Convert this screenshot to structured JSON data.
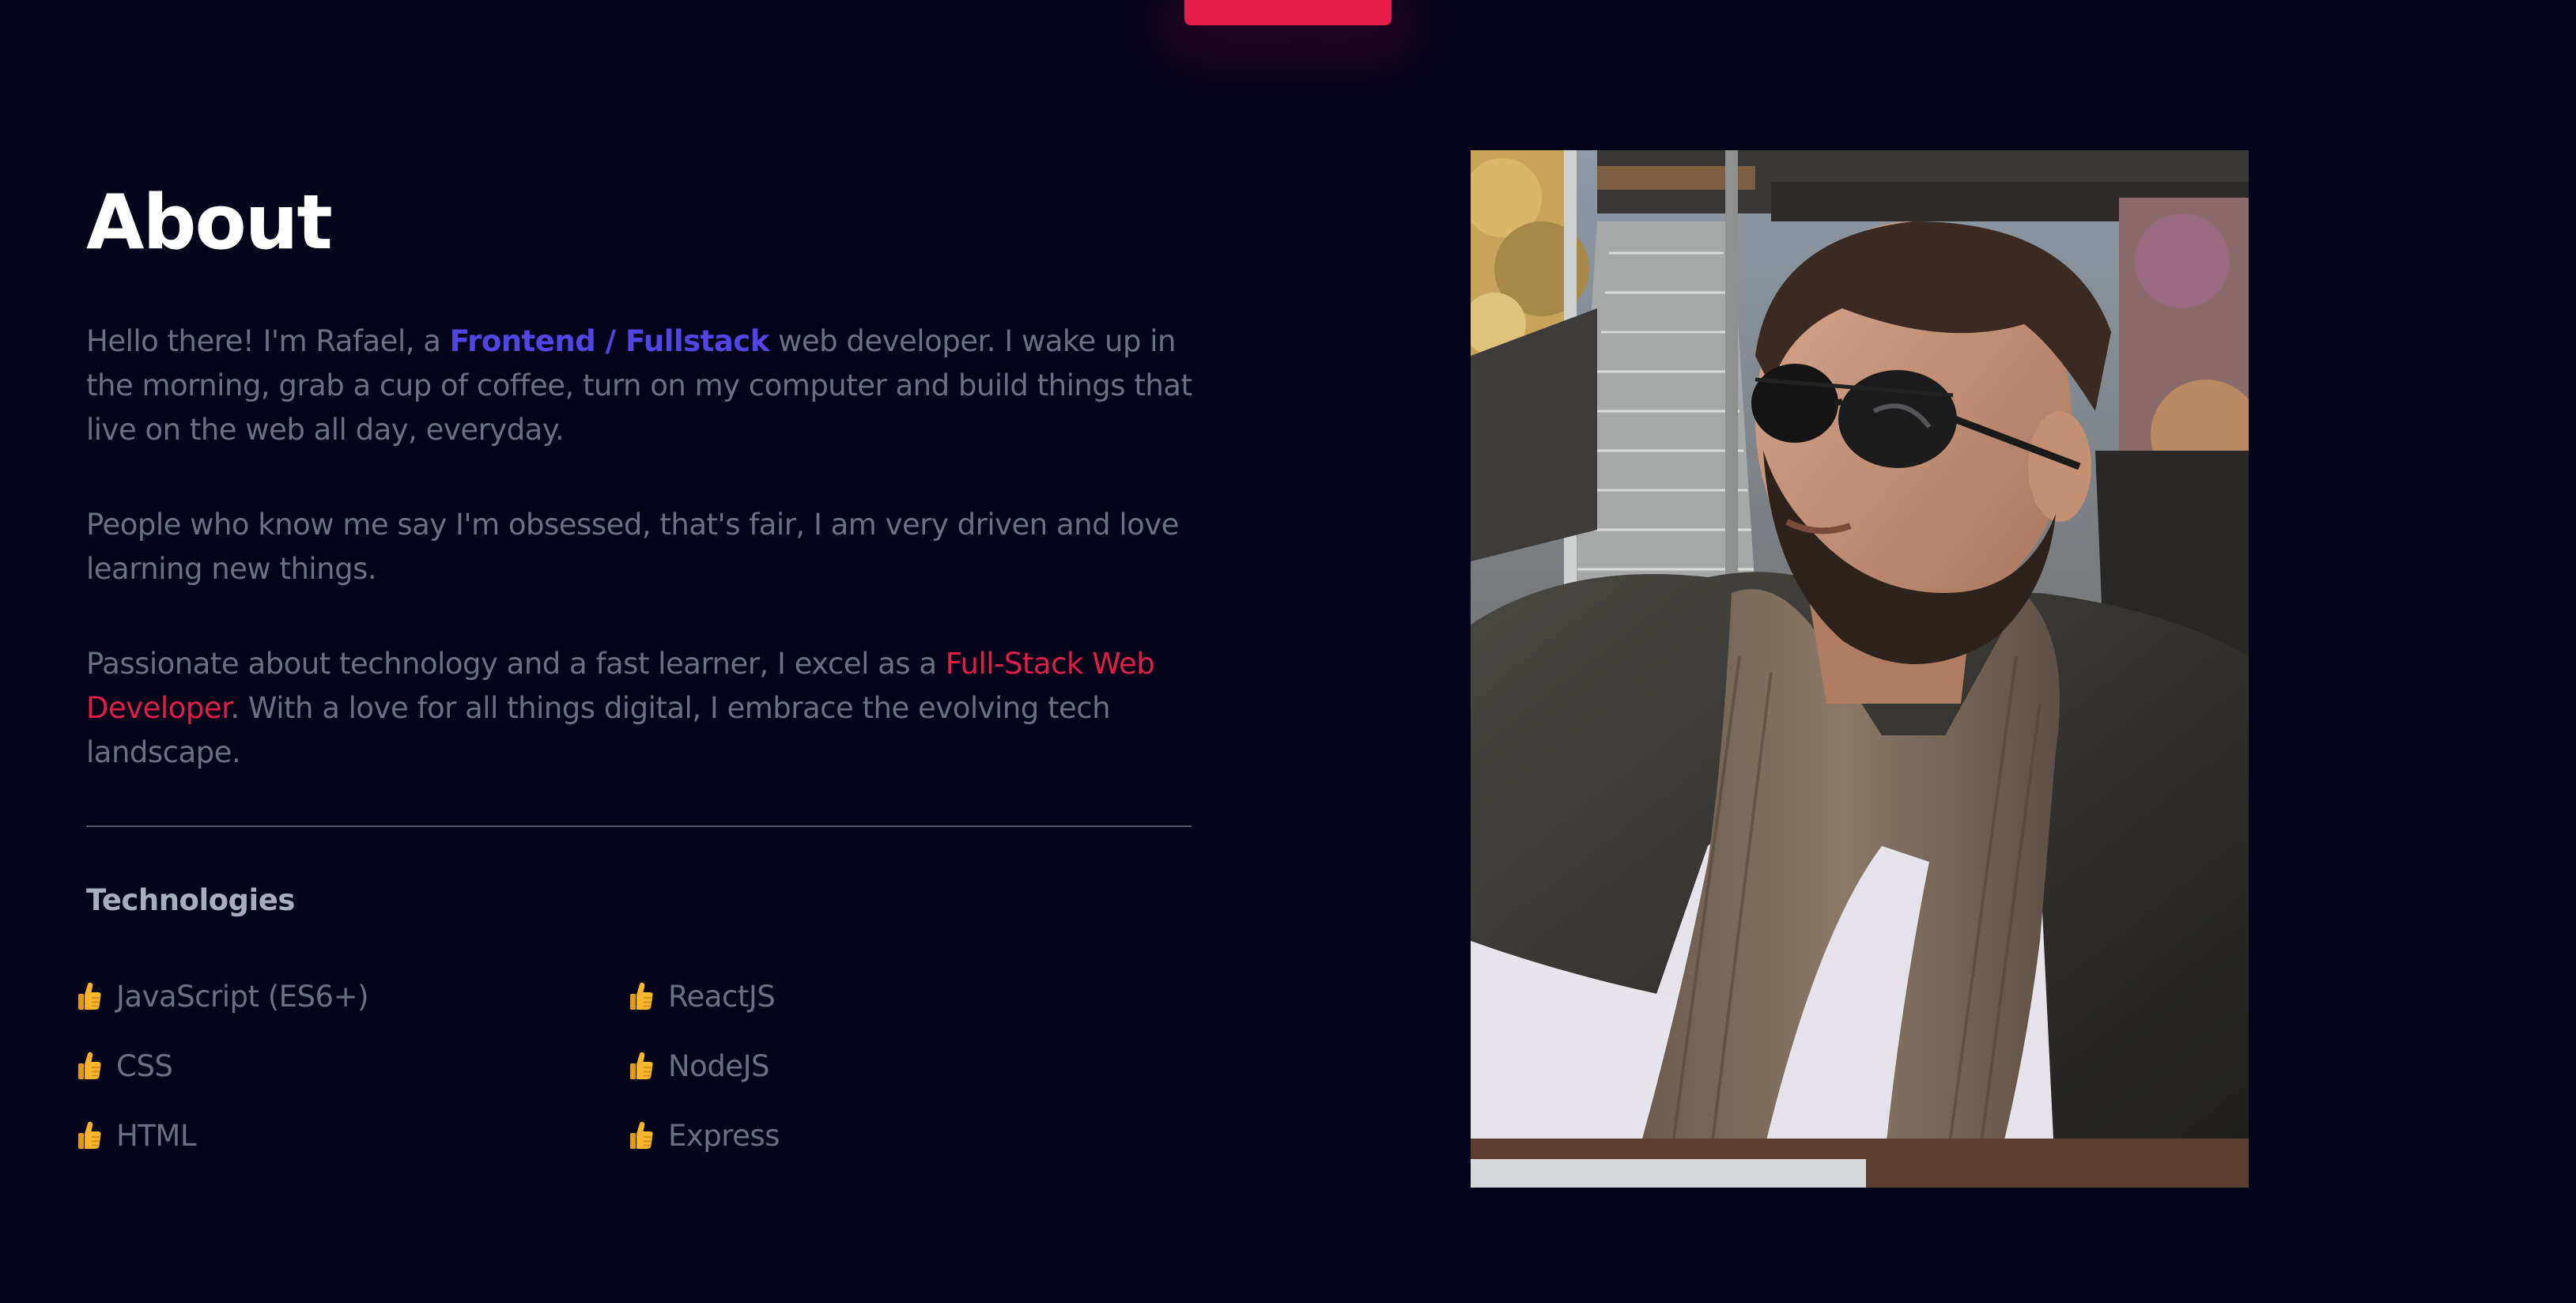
{
  "about": {
    "title": "About",
    "paragraph1": {
      "before": "Hello there! I'm Rafael, a ",
      "highlight": "Frontend / Fullstack",
      "after": " web developer. I wake up in the morning, grab a cup of coffee, turn on my computer and build things that live on the web all day, everyday."
    },
    "paragraph2": "People who know me say I'm obsessed, that's fair, I am very driven and love learning new things.",
    "paragraph3": {
      "before": "Passionate about technology and a fast learner, I excel as a ",
      "highlight": "Full-Stack Web Developer",
      "after": ". With a love for all things digital, I embrace the evolving tech landscape."
    }
  },
  "technologies": {
    "title": "Technologies",
    "items": [
      "JavaScript (ES6+)",
      "ReactJS",
      "CSS",
      "NodeJS",
      "HTML",
      "Express"
    ],
    "bullet_icon": "thumbs-up-icon"
  },
  "photo": {
    "subject": "portrait-photo"
  },
  "colors": {
    "background": "#03041a",
    "accent_red": "#e11d48",
    "accent_blue": "#5046e5",
    "body_text": "#6b7080",
    "heading": "#ffffff"
  }
}
